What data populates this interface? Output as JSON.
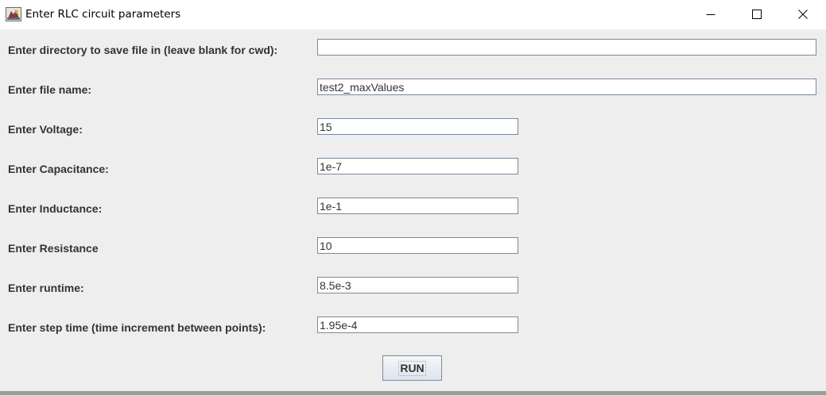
{
  "window": {
    "title": "Enter RLC circuit parameters",
    "icons": {
      "app": "java-app-icon",
      "minimize": "minimize-icon",
      "maximize": "maximize-icon",
      "close": "close-icon"
    }
  },
  "form": {
    "fields": [
      {
        "label": "Enter directory to save file in (leave blank for cwd):",
        "value": ""
      },
      {
        "label": "Enter file name:",
        "value": "test2_maxValues"
      },
      {
        "label": "Enter Voltage:",
        "value": "15"
      },
      {
        "label": "Enter Capacitance:",
        "value": "1e-7"
      },
      {
        "label": "Enter Inductance:",
        "value": "1e-1"
      },
      {
        "label": "Enter Resistance",
        "value": "10"
      },
      {
        "label": "Enter runtime:",
        "value": "8.5e-3"
      },
      {
        "label": "Enter step time (time increment between points):",
        "value": "1.95e-4"
      }
    ],
    "run_label": "RUN"
  }
}
